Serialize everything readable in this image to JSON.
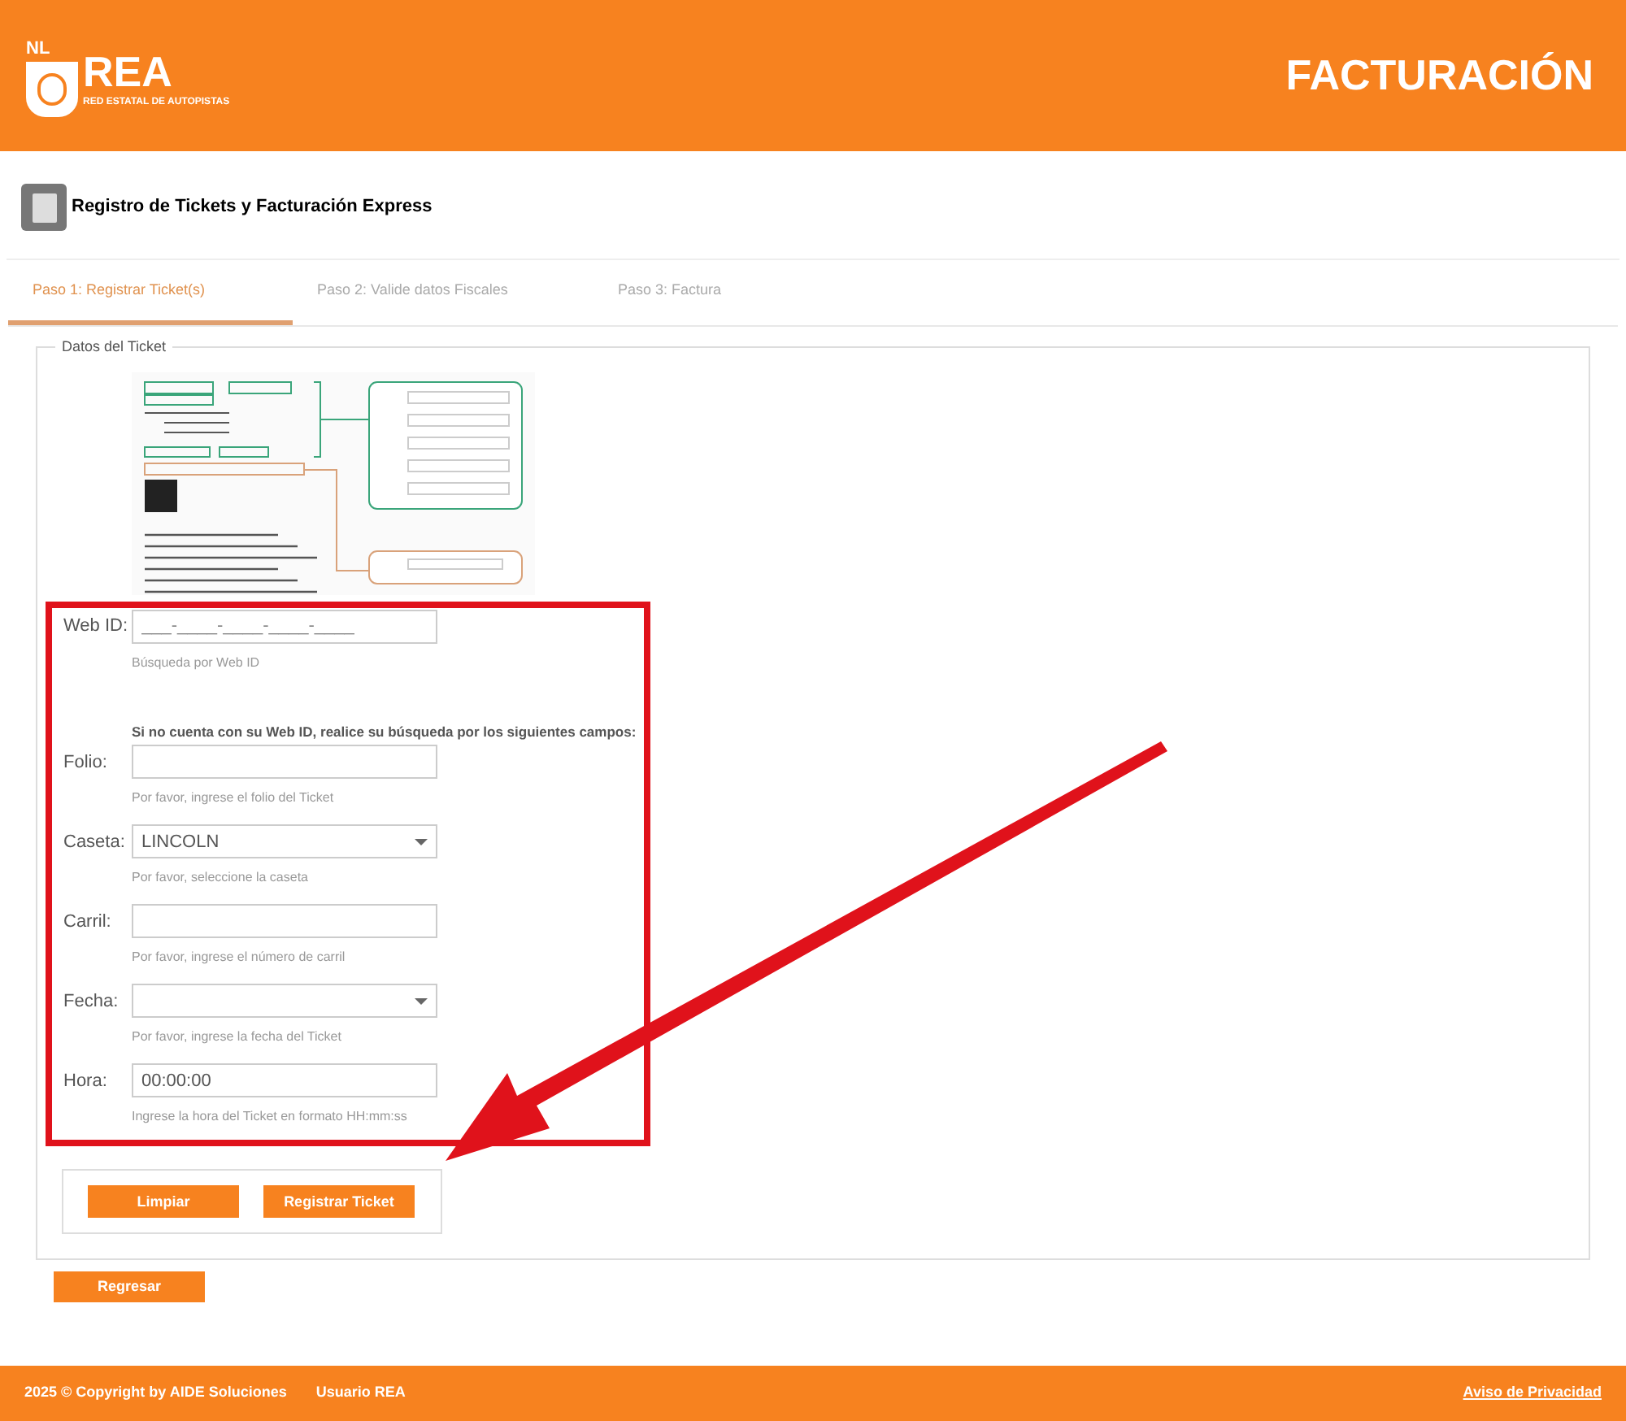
{
  "header": {
    "logo_small": "NL",
    "logo": "REA",
    "logo_tagline": "RED ESTATAL DE AUTOPISTAS",
    "title": "FACTURACIÓN"
  },
  "page_title": "Registro de Tickets y Facturación Express",
  "tabs": [
    {
      "label": "Paso 1: Registrar Ticket(s)",
      "selected": true
    },
    {
      "label": "Paso 2: Valide datos Fiscales",
      "selected": false
    },
    {
      "label": "Paso 3: Factura",
      "selected": false
    }
  ],
  "fieldset": {
    "legend": "Datos del Ticket"
  },
  "web_id": {
    "label": "Web ID:",
    "placeholder": "___-____-____-____-____",
    "help": "Búsqueda por Web ID"
  },
  "alt_search_heading": "Si no cuenta con su Web ID, realice su búsqueda por los siguientes campos:",
  "fields": [
    {
      "kind": "text",
      "label": "Folio:",
      "help": "Por favor, ingrese el folio del Ticket"
    },
    {
      "kind": "select",
      "label": "Caseta:",
      "value": "LINCOLN",
      "help": "Por favor, seleccione la caseta"
    },
    {
      "kind": "text",
      "label": "Carril:",
      "help": "Por favor, ingrese el número de carril"
    },
    {
      "kind": "select",
      "label": "Fecha:",
      "help": "Por favor, ingrese la fecha del Ticket"
    },
    {
      "kind": "text",
      "label": "Hora:",
      "value": "00:00:00",
      "help": "Ingrese la hora del Ticket en formato HH:mm:ss"
    }
  ],
  "buttons": [
    "Limpiar",
    "Registrar Ticket"
  ],
  "back_button": "Regresar",
  "footer": {
    "copyright": "2025 © Copyright by AIDE Soluciones",
    "user": "Usuario REA",
    "privacy_link": "Aviso de Privacidad"
  }
}
